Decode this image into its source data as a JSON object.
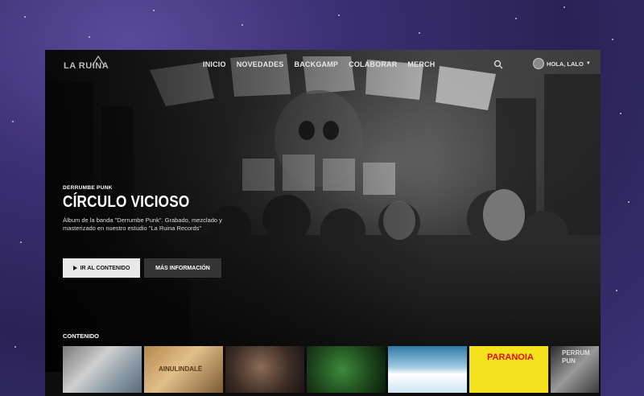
{
  "nav": {
    "logo": "LA RUINA",
    "items": [
      "INICIO",
      "NOVEDADES",
      "BACKGAMP",
      "COLABORAR",
      "MERCH"
    ],
    "user_label": "HOLA, LALO"
  },
  "hero": {
    "eyebrow": "DERRUMBE PUNK",
    "title": "CÍRCULO VICIOSO",
    "description": "Álbum de la banda \"Derrumbe Punk\". Grabado, mezclado y masterizado en nuestro estudio \"La Ruina Records\"",
    "play_label": "IR AL CONTENIDO",
    "info_label": "MÁS INFORMACIÓN"
  },
  "content": {
    "title": "CONTENIDO",
    "thumbnails": [
      {
        "name": "thumb-city"
      },
      {
        "name": "thumb-ainulindale",
        "label": "AINULINDALË"
      },
      {
        "name": "thumb-figure"
      },
      {
        "name": "thumb-green"
      },
      {
        "name": "thumb-snow"
      },
      {
        "name": "thumb-paranoia",
        "label": "PARANOIA"
      },
      {
        "name": "thumb-derrumbe",
        "label": "PERRUM PUN"
      }
    ]
  }
}
